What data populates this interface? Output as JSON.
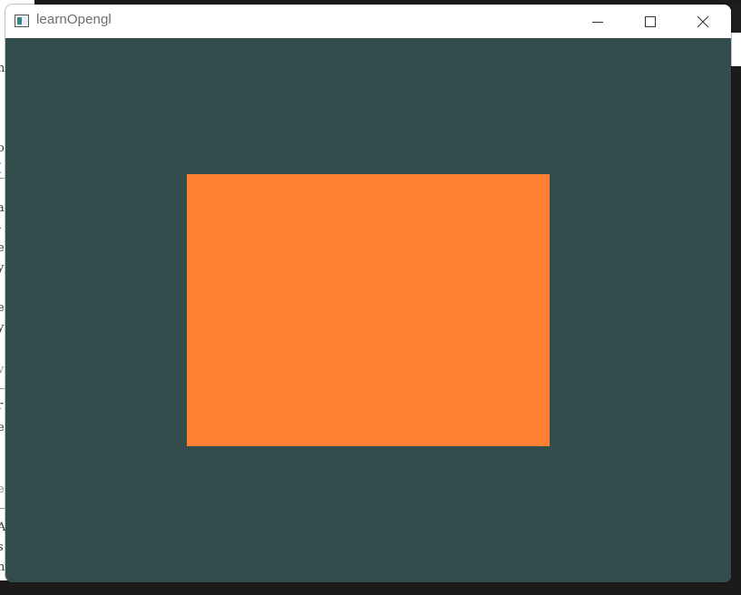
{
  "window": {
    "title": "learnOpengl",
    "app_icon": "window-app-icon",
    "controls": {
      "minimize_icon": "minimize-icon",
      "maximize_icon": "maximize-icon",
      "close_icon": "close-icon"
    }
  },
  "scene": {
    "clear_color": "#334d4d",
    "quad_color": "#ff7f33"
  },
  "background_fragments": [
    "n",
    "o",
    "(",
    "a",
    "-",
    "e",
    "y",
    "e",
    "y",
    "v",
    "r",
    "e",
    "e",
    "A",
    "s",
    "n"
  ]
}
